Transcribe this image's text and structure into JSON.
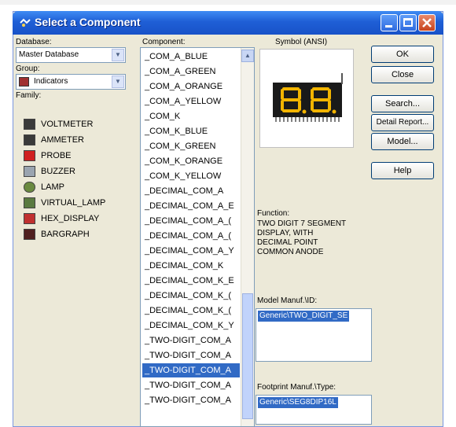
{
  "window": {
    "title": "Select a Component"
  },
  "labels": {
    "database": "Database:",
    "component": "Component:",
    "symbol": "Symbol (ANSI)",
    "group": "Group:",
    "family": "Family:",
    "function": "Function:",
    "model_manuf": "Model Manuf.\\ID:",
    "footprint_manuf": "Footprint Manuf.\\Type:"
  },
  "database_select": {
    "value": "Master Database"
  },
  "group_select": {
    "value": "Indicators"
  },
  "family": {
    "items": [
      {
        "label": "VOLTMETER",
        "icon": "voltmeter-icon",
        "color": "#3a3a3a"
      },
      {
        "label": "AMMETER",
        "icon": "ammeter-icon",
        "color": "#3a3a3a"
      },
      {
        "label": "PROBE",
        "icon": "probe-icon",
        "color": "#d02020"
      },
      {
        "label": "BUZZER",
        "icon": "buzzer-icon",
        "color": "#9aa4b0"
      },
      {
        "label": "LAMP",
        "icon": "lamp-icon",
        "color": "#6a8a40"
      },
      {
        "label": "VIRTUAL_LAMP",
        "icon": "virtual-lamp-icon",
        "color": "#5a7a40"
      },
      {
        "label": "HEX_DISPLAY",
        "icon": "hex-display-icon",
        "color": "#c03030"
      },
      {
        "label": "BARGRAPH",
        "icon": "bargraph-icon",
        "color": "#502020"
      }
    ]
  },
  "components": {
    "items": [
      "_COM_A_BLUE",
      "_COM_A_GREEN",
      "_COM_A_ORANGE",
      "_COM_A_YELLOW",
      "_COM_K",
      "_COM_K_BLUE",
      "_COM_K_GREEN",
      "_COM_K_ORANGE",
      "_COM_K_YELLOW",
      "_DECIMAL_COM_A",
      "_DECIMAL_COM_A_E",
      "_DECIMAL_COM_A_(",
      "_DECIMAL_COM_A_(",
      "_DECIMAL_COM_A_Y",
      "_DECIMAL_COM_K",
      "_DECIMAL_COM_K_E",
      "_DECIMAL_COM_K_(",
      "_DECIMAL_COM_K_(",
      "_DECIMAL_COM_K_Y",
      "_TWO-DIGIT_COM_A",
      "_TWO-DIGIT_COM_A",
      "_TWO-DIGIT_COM_A",
      "_TWO-DIGIT_COM_A",
      "_TWO-DIGIT_COM_A"
    ],
    "selected_index": 21
  },
  "symbol": {
    "digits": "8.8."
  },
  "buttons": {
    "ok": "OK",
    "close": "Close",
    "search": "Search...",
    "detail_report": "Detail Report...",
    "model": "Model...",
    "help": "Help"
  },
  "function_text": {
    "lines": [
      "TWO DIGIT 7 SEGMENT",
      "DISPLAY, WITH",
      "DECIMAL POINT",
      "COMMON ANODE"
    ]
  },
  "model_manuf": {
    "value": "Generic\\TWO_DIGIT_SE"
  },
  "footprint_manuf": {
    "value": "Generic\\SEG8DIP16L"
  },
  "colors": {
    "title_bar": "#1f5fd6",
    "selection": "#316ac5",
    "dialog_bg": "#ece9d8",
    "segment_on": "#f2b400"
  }
}
